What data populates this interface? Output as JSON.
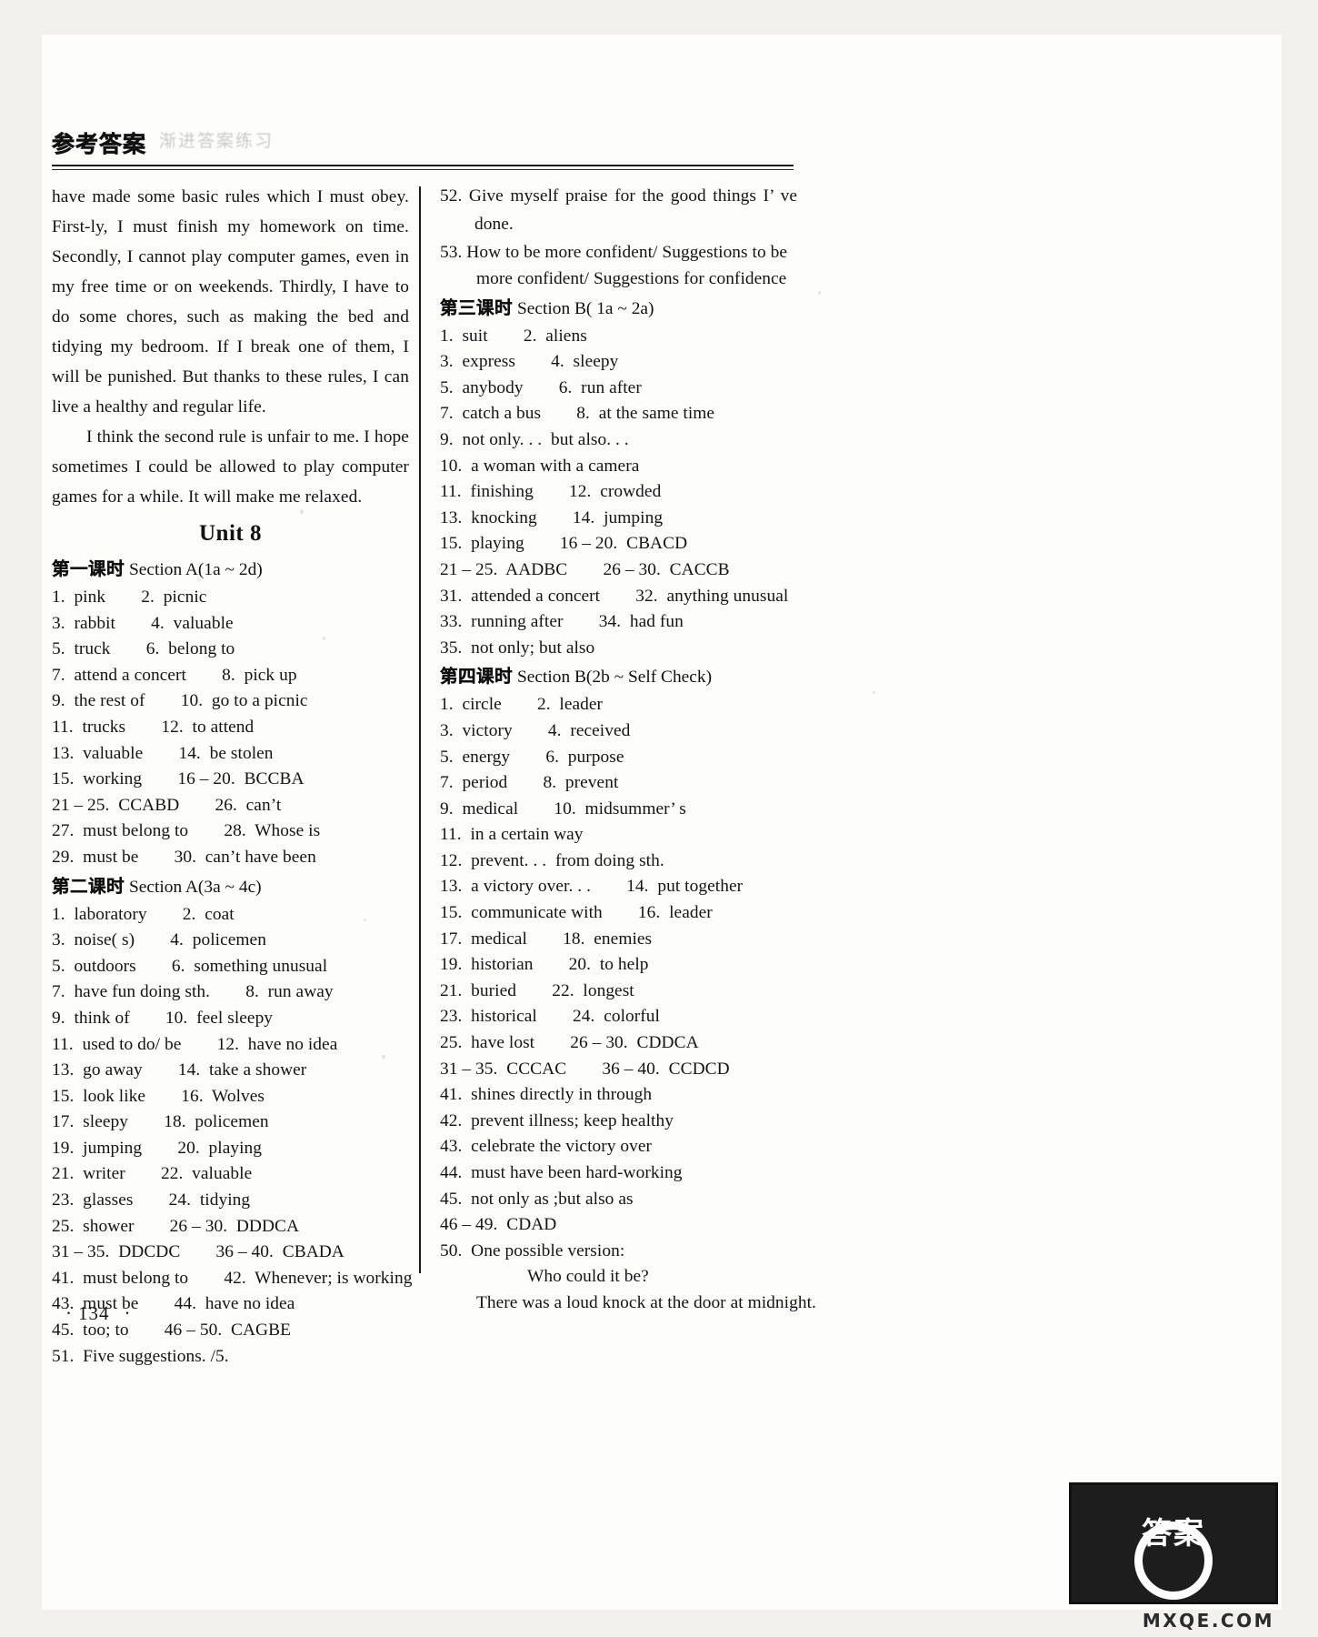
{
  "page": {
    "running_head_zh": "参考答案",
    "running_head_smudge": "渐进答案练习",
    "folio_number": "134",
    "folio_dot_left": "·",
    "folio_dot_right": "·",
    "logo_zh": "答案",
    "logo_caption": "MXQE.COM"
  },
  "left_column": {
    "paragraph_1": "have made some basic rules which I must obey.  First-ly, I must finish my homework on time.  Secondly, I cannot play computer games, even in my free time or on weekends.  Thirdly, I have to do some chores, such as making the bed and tidying my bedroom.  If I break one of them, I will be punished.  But thanks to these rules, I can live a healthy and regular life.",
    "paragraph_2": "I think the second rule is unfair to me.  I hope sometimes I could be allowed to play computer games for a while.  It will make me relaxed.",
    "unit_title": "Unit 8",
    "lesson_1": {
      "zh": "第一课时",
      "en": "Section A(1a ~ 2d)"
    },
    "lesson_1_answers": [
      "1.  pink        2.  picnic",
      "3.  rabbit        4.  valuable",
      "5.  truck        6.  belong to",
      "7.  attend a concert        8.  pick up",
      "9.  the rest of        10.  go to a picnic",
      "11.  trucks        12.  to attend",
      "13.  valuable        14.  be stolen",
      "15.  working        16 – 20.  BCCBA",
      "21 – 25.  CCABD        26.  can’t",
      "27.  must belong to        28.  Whose is",
      "29.  must be        30.  can’t have been"
    ],
    "lesson_2": {
      "zh": "第二课时",
      "en": "Section A(3a ~ 4c)"
    },
    "lesson_2_answers": [
      "1.  laboratory        2.  coat",
      "3.  noise( s)        4.  policemen",
      "5.  outdoors        6.  something unusual",
      "7.  have fun doing sth.        8.  run away",
      "9.  think of        10.  feel sleepy",
      "11.  used to do/ be        12.  have no idea",
      "13.  go away        14.  take a shower",
      "15.  look like        16.  Wolves",
      "17.  sleepy        18.  policemen",
      "19.  jumping        20.  playing",
      "21.  writer        22.  valuable",
      "23.  glasses        24.  tidying",
      "25.  shower        26 – 30.  DDDCA",
      "31 – 35.  DDCDC        36 – 40.  CBADA",
      "41.  must belong to        42.  Whenever; is working",
      "43.  must be        44.  have no idea",
      "45.  too; to        46 – 50.  CAGBE",
      "51.  Five suggestions. /5."
    ]
  },
  "right_column": {
    "answer_52": "52.  Give myself praise for the good things I’ ve done.",
    "answer_53_line1": "53.  How to be more confident/ Suggestions to be",
    "answer_53_line2": "more confident/ Suggestions for confidence",
    "lesson_3": {
      "zh": "第三课时",
      "en": "Section B( 1a ~ 2a)"
    },
    "lesson_3_answers": [
      "1.  suit        2.  aliens",
      "3.  express        4.  sleepy",
      "5.  anybody        6.  run after",
      "7.  catch a bus        8.  at the same time",
      "9.  not only. . .  but also. . .",
      "10.  a woman with a camera",
      "11.  finishing        12.  crowded",
      "13.  knocking        14.  jumping",
      "15.  playing        16 – 20.  CBACD",
      "21 – 25.  AADBC        26 – 30.  CACCB",
      "31.  attended a concert        32.  anything unusual",
      "33.  running after        34.  had fun",
      "35.  not only; but also"
    ],
    "lesson_4": {
      "zh": "第四课时",
      "en": "Section B(2b ~ Self Check)"
    },
    "lesson_4_answers": [
      "1.  circle        2.  leader",
      "3.  victory        4.  received",
      "5.  energy        6.  purpose",
      "7.  period        8.  prevent",
      "9.  medical        10.  midsummer’ s",
      "11.  in a certain way",
      "12.  prevent. . .  from doing sth.",
      "13.  a victory over. . .        14.  put together",
      "15.  communicate with        16.  leader",
      "17.  medical        18.  enemies",
      "19.  historian        20.  to help",
      "21.  buried        22.  longest",
      "23.  historical        24.  colorful",
      "25.  have lost        26 – 30.  CDDCA",
      "31 – 35.  CCCAC        36 – 40.  CCDCD",
      "41.  shines directly in through",
      "42.  prevent illness; keep healthy",
      "43.  celebrate the victory over",
      "44.  must have been hard-working",
      "45.  not only as ;but also as",
      "46 – 49.  CDAD",
      "50.  One possible version:"
    ],
    "answer_50_line1": "Who could it be?",
    "answer_50_line2": "There was a loud knock at the door at midnight."
  }
}
